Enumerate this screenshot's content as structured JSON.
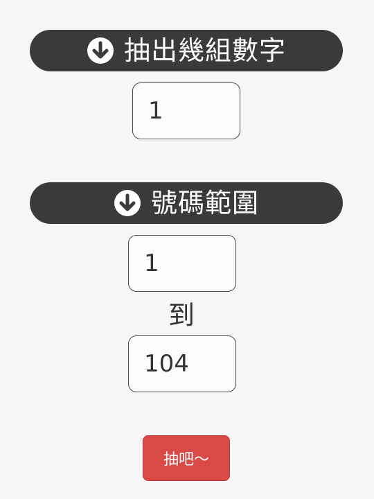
{
  "colors": {
    "background": "#f7f5f8",
    "header_bg": "#3b393c",
    "header_text": "#ffffff",
    "button_bg": "#d94a46",
    "button_text": "#ffffff"
  },
  "groups_section": {
    "icon": "arrow-down-circle-icon",
    "title": "抽出幾組數字",
    "count_value": "1"
  },
  "range_section": {
    "icon": "arrow-down-circle-icon",
    "title": "號碼範圍",
    "min_value": "1",
    "to_label": "到",
    "max_value": "104"
  },
  "draw_button": {
    "label": "抽吧～"
  }
}
